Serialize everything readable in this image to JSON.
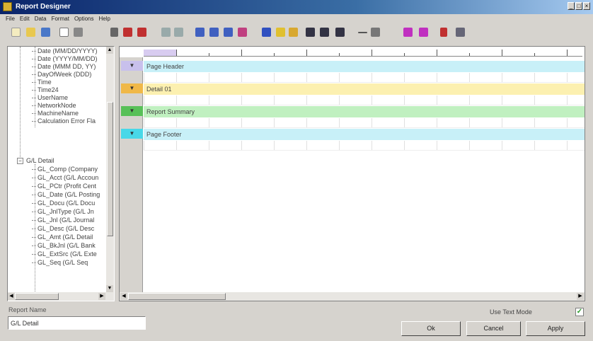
{
  "window": {
    "title": "Report Designer"
  },
  "menu": [
    "File",
    "Edit",
    "Data",
    "Format",
    "Options",
    "Help"
  ],
  "toolbar": {
    "icons": [
      "new-icon",
      "open-icon",
      "save-icon",
      "copy-icon",
      "print-icon",
      "cut-icon",
      "undo-icon",
      "redo-icon",
      "zoom-in-icon",
      "zoom-out-icon",
      "align-left-icon",
      "align-center-icon",
      "align-right-icon",
      "chart-icon",
      "text-icon",
      "field-icon",
      "image-icon",
      "grid-icon",
      "line-icon",
      "box-icon",
      "table-icon",
      "pen-icon",
      "magnet-icon",
      "sort-icon",
      "properties-icon"
    ]
  },
  "tree": {
    "items": [
      {
        "label": "Date (MM/DD/YYYY)"
      },
      {
        "label": "Date (YYYY/MM/DD)"
      },
      {
        "label": "Date (MMM DD, YY)"
      },
      {
        "label": "DayOfWeek (DDD)"
      },
      {
        "label": "Time"
      },
      {
        "label": "Time24"
      },
      {
        "label": "UserName"
      },
      {
        "label": "NetworkNode"
      },
      {
        "label": "MachineName"
      },
      {
        "label": "Calculation Error Fla"
      },
      {
        "label": "G/L Detail"
      },
      {
        "label": "GL_Comp (Company"
      },
      {
        "label": "GL_Acct (G/L Accoun"
      },
      {
        "label": "GL_PCtr (Profit Cent"
      },
      {
        "label": "GL_Date (G/L Posting"
      },
      {
        "label": "GL_Docu (G/L Docu"
      },
      {
        "label": "GL_JnlType (G/L Jn"
      },
      {
        "label": "GL_Jnl (G/L Journal"
      },
      {
        "label": "GL_Desc (G/L Desc"
      },
      {
        "label": "GL_Amt (G/L Detail"
      },
      {
        "label": "GL_BkJnl (G/L Bank"
      },
      {
        "label": "GL_ExtSrc (G/L Exte"
      },
      {
        "label": "GL_Seq (G/L Seq"
      }
    ]
  },
  "designer": {
    "bands": [
      {
        "label": "Page Header",
        "color": "#c8f0f8",
        "btn_color": "#c8c0ec"
      },
      {
        "label": "Detail 01",
        "color": "#fcf0b0",
        "btn_color": "#f0b848"
      },
      {
        "label": "Report Summary",
        "color": "#c0f0c0",
        "btn_color": "#58c058"
      },
      {
        "label": "Page Footer",
        "color": "#c8f0f8",
        "btn_color": "#48d8e8"
      }
    ]
  },
  "form": {
    "report_name_label": "Report Name",
    "report_name_value": "G/L Detail",
    "text_mode_label": "Use Text Mode",
    "text_mode_checked": true
  },
  "buttons": {
    "ok": "Ok",
    "cancel": "Cancel",
    "apply": "Apply"
  }
}
